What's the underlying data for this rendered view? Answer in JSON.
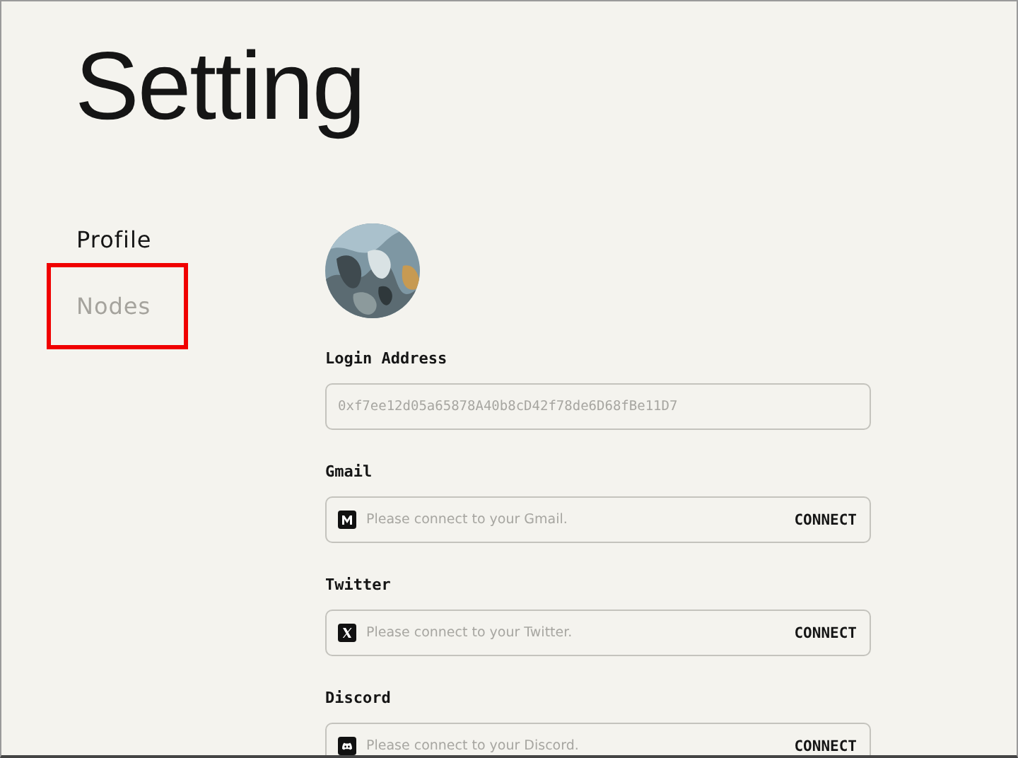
{
  "page_title": "Setting",
  "sidebar": {
    "items": [
      {
        "label": "Profile",
        "selected": true,
        "highlighted": false
      },
      {
        "label": "Nodes",
        "selected": false,
        "highlighted": true
      }
    ]
  },
  "profile": {
    "fields": [
      {
        "kind": "address",
        "label": "Login Address",
        "value": "0xf7ee12d05a65878A40b8cD42f78de6D68fBe11D7"
      },
      {
        "kind": "gmail",
        "label": "Gmail",
        "placeholder": "Please connect to your Gmail.",
        "action": "CONNECT"
      },
      {
        "kind": "twitter",
        "label": "Twitter",
        "placeholder": "Please connect to your Twitter.",
        "action": "CONNECT"
      },
      {
        "kind": "discord",
        "label": "Discord",
        "placeholder": "Please connect to your Discord.",
        "action": "CONNECT"
      }
    ]
  }
}
